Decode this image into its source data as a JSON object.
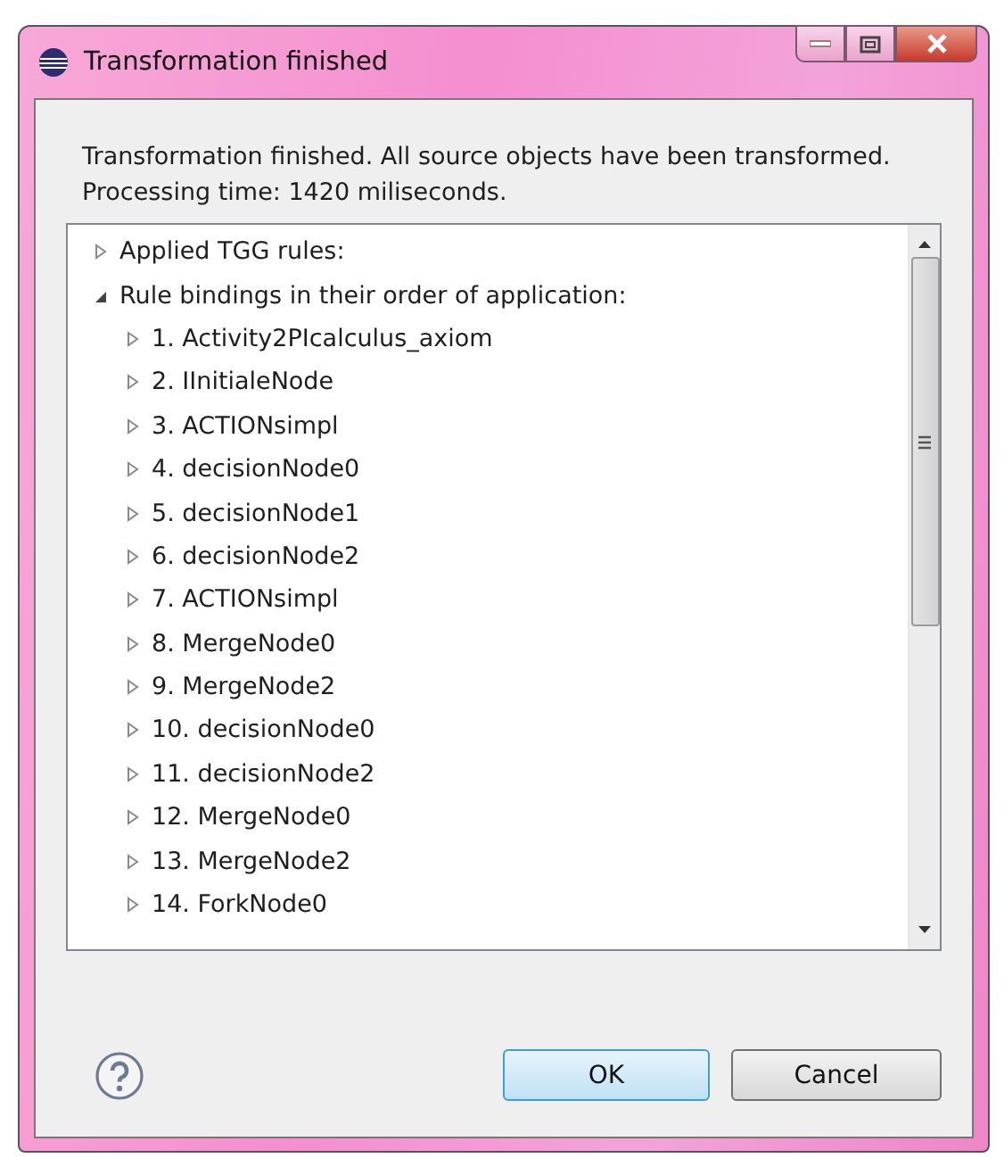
{
  "window": {
    "title": "Transformation finished"
  },
  "message": [
    "Transformation finished. All source objects have been transformed.",
    "Processing time: 1420 miliseconds."
  ],
  "tree": [
    {
      "label": "Applied TGG rules:",
      "expanded": false
    },
    {
      "label": "Rule bindings in their order of application:",
      "expanded": true,
      "children": [
        {
          "label": "1. Activity2PIcalculus_axiom",
          "expanded": false
        },
        {
          "label": "2. IInitialeNode",
          "expanded": false
        },
        {
          "label": "3. ACTIONsimpl",
          "expanded": false
        },
        {
          "label": "4. decisionNode0",
          "expanded": false
        },
        {
          "label": "5. decisionNode1",
          "expanded": false
        },
        {
          "label": "6. decisionNode2",
          "expanded": false
        },
        {
          "label": "7. ACTIONsimpl",
          "expanded": false
        },
        {
          "label": "8. MergeNode0",
          "expanded": false
        },
        {
          "label": "9. MergeNode2",
          "expanded": false
        },
        {
          "label": "10. decisionNode0",
          "expanded": false
        },
        {
          "label": "11. decisionNode2",
          "expanded": false
        },
        {
          "label": "12. MergeNode0",
          "expanded": false
        },
        {
          "label": "13. MergeNode2",
          "expanded": false
        },
        {
          "label": "14. ForkNode0",
          "expanded": false
        }
      ]
    }
  ],
  "buttons": [
    "OK",
    "Cancel"
  ]
}
